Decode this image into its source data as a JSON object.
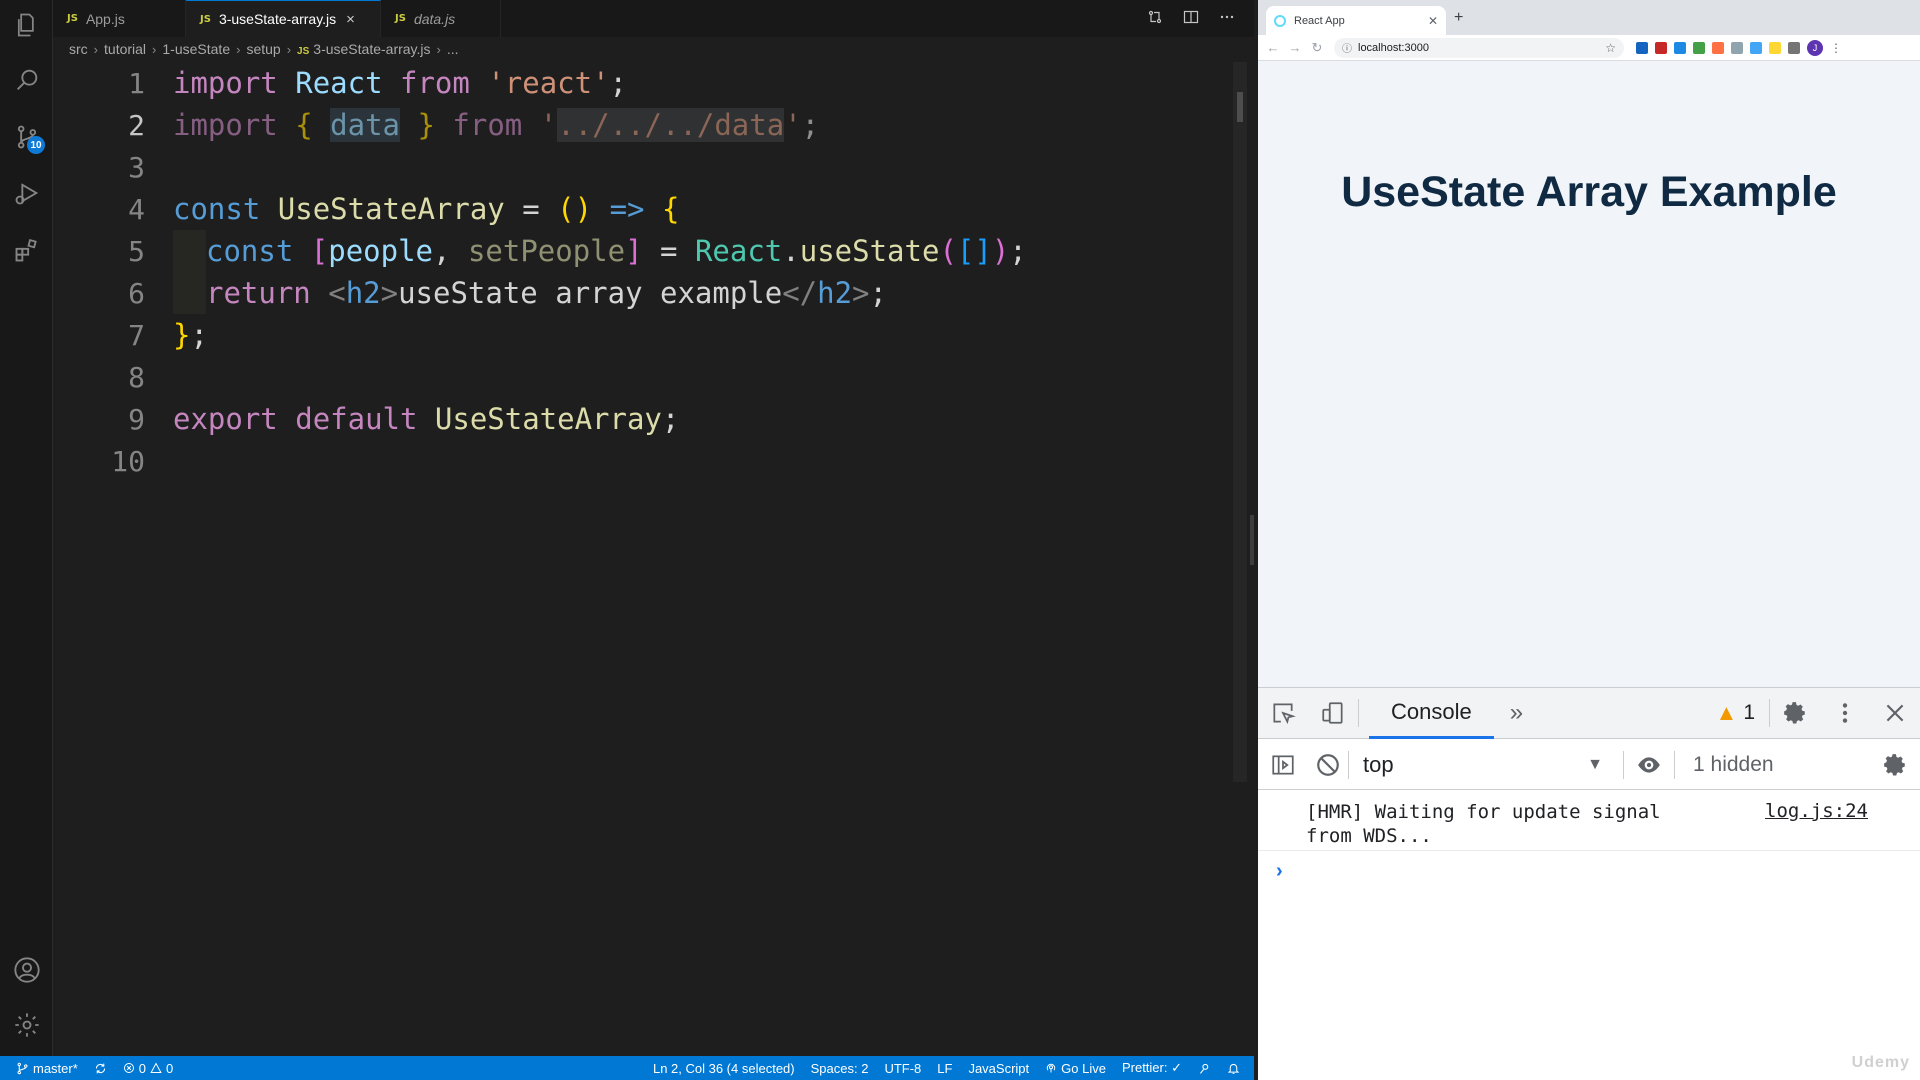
{
  "editor": {
    "tabs": [
      {
        "label": "App.js",
        "icon": "JS"
      },
      {
        "label": "3-useState-array.js",
        "icon": "JS",
        "close": "×"
      },
      {
        "label": "data.js",
        "icon": "JS"
      }
    ],
    "breadcrumb": [
      "src",
      "tutorial",
      "1-useState",
      "setup",
      "3-useState-array.js",
      "..."
    ],
    "line_numbers": [
      "1",
      "2",
      "3",
      "4",
      "5",
      "6",
      "7",
      "8",
      "9",
      "10"
    ],
    "code": {
      "l1": {
        "kw": "import",
        "id": "React",
        "from": "from",
        "str": "'react'",
        "end": ";"
      },
      "l2": {
        "kw": "import",
        "open": "{",
        "id": "data",
        "close": "}",
        "from": "from",
        "q1": "'",
        "path": "../../../",
        "sel": "data",
        "q2": "'",
        "end": ";"
      },
      "l4": {
        "const": "const",
        "name": "UseStateArray",
        "eq": "=",
        "paren": "()",
        "arrow": "=>",
        "brace": "{"
      },
      "l5": {
        "const": "const",
        "ob": "[",
        "a": "people",
        "comma": ",",
        "b": "setPeople",
        "cb": "]",
        "eq": "=",
        "obj": "React",
        "dot": ".",
        "fn": "useState",
        "op": "(",
        "arr": "[]",
        "cp": ")",
        "end": ";"
      },
      "l6": {
        "ret": "return",
        "lt": "<",
        "tag": "h2",
        "gt": ">",
        "text": "useState array example",
        "lt2": "</",
        "tag2": "h2",
        "gt2": ">",
        "end": ";"
      },
      "l7": {
        "brace": "}",
        "end": ";"
      },
      "l9": {
        "exp": "export",
        "def": "default",
        "name": "UseStateArray",
        "end": ";"
      }
    },
    "activity_badge": "10"
  },
  "statusbar": {
    "branch": "master*",
    "errors": "0",
    "warnings": "0",
    "position": "Ln 2, Col 36 (4 selected)",
    "spaces": "Spaces: 2",
    "encoding": "UTF-8",
    "eol": "LF",
    "language": "JavaScript",
    "golive": "Go Live",
    "prettier": "Prettier: ✓"
  },
  "browser": {
    "tab_title": "React App",
    "url": "localhost:3000",
    "profile_initial": "J",
    "page_heading": "UseState Array Example"
  },
  "devtools": {
    "tab": "Console",
    "warning_count": "1",
    "context": "top",
    "hidden": "1 hidden",
    "message": "[HMR] Waiting for update signal from WDS...",
    "source": "log.js:24"
  },
  "watermark": "Udemy"
}
